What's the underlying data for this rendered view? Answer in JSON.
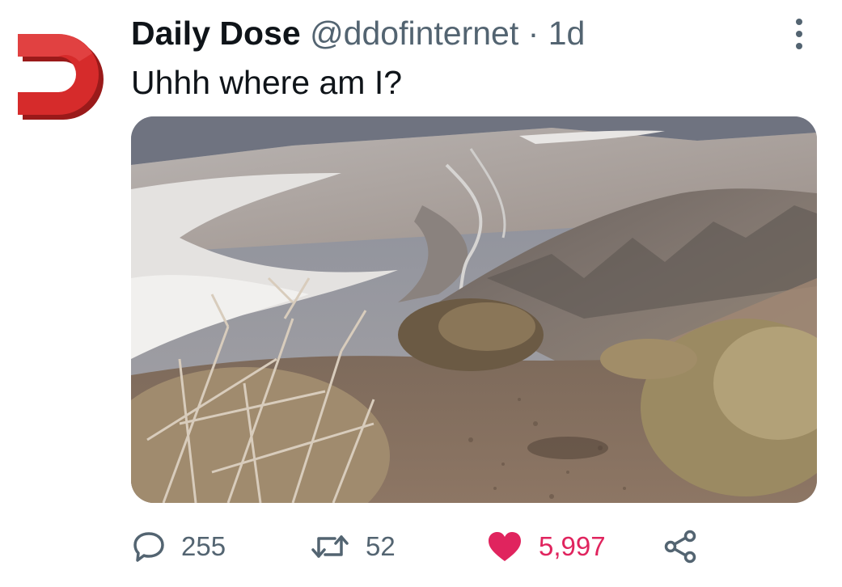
{
  "tweet": {
    "author_name": "Daily Dose",
    "author_handle": "@ddofinternet",
    "separator": "·",
    "timestamp": "1d",
    "text": "Uhhh where am I?",
    "avatar_icon": "red-d-logo-icon",
    "media_icon": "landscape-photo",
    "more_icon": "more-vertical-icon"
  },
  "actions": {
    "reply": {
      "icon": "reply-icon",
      "count": "255"
    },
    "retweet": {
      "icon": "retweet-icon",
      "count": "52"
    },
    "like": {
      "icon": "heart-icon",
      "count": "5,997",
      "color": "#e0245e"
    },
    "share": {
      "icon": "share-icon"
    }
  },
  "colors": {
    "text": "#0f1419",
    "secondary": "#536471",
    "like": "#e0245e",
    "avatar_red": "#d42a2a"
  }
}
